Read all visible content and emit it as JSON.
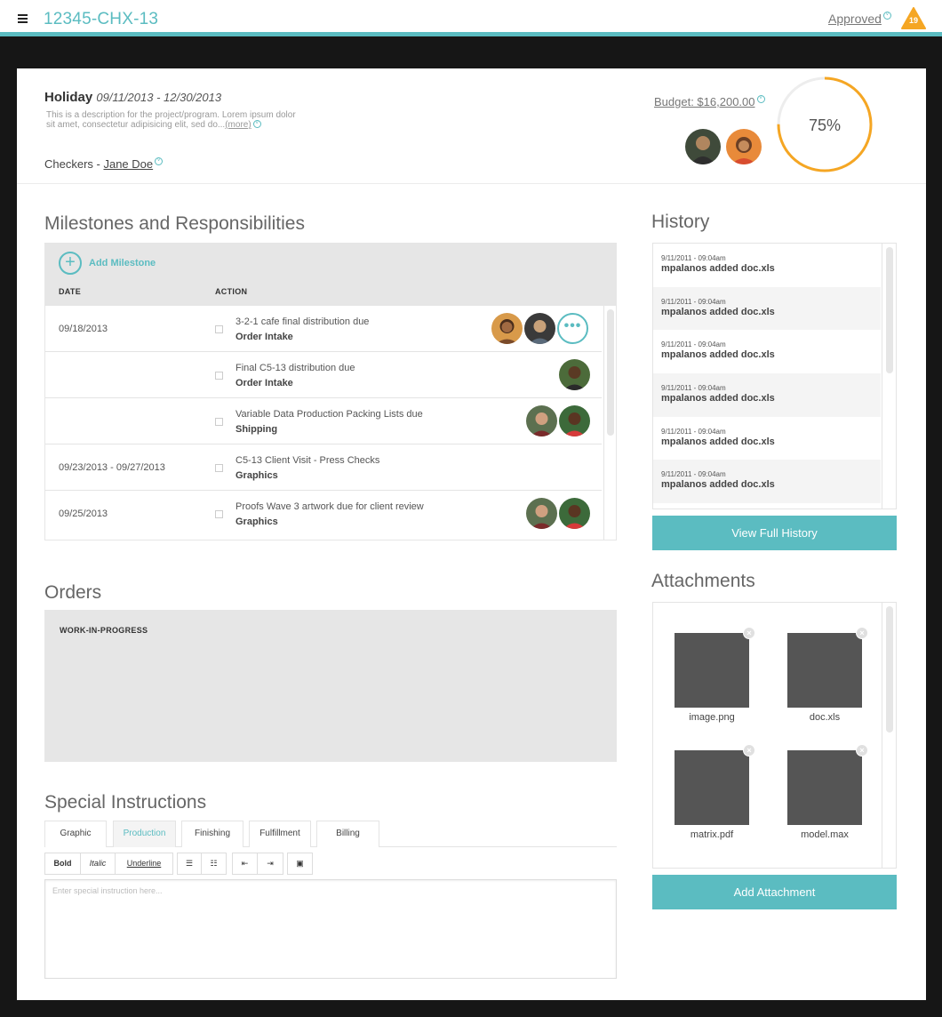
{
  "header": {
    "project_id": "12345-CHX-13",
    "status": "Approved",
    "alert_count": "19"
  },
  "project": {
    "name": "Holiday",
    "dates": "09/11/2013 - 12/30/2013",
    "description": "This is a description for the project/program. Lorem ipsum dolor sit amet, consectetur adipisicing elit, sed do...",
    "more_link": "(more)",
    "checkers_label": "Checkers - ",
    "checker_name": "Jane Doe",
    "budget": "Budget: $16,200.00",
    "progress_text": "75%",
    "progress_value": 0.75
  },
  "milestones": {
    "title": "Milestones and Responsibilities",
    "add_label": "Add Milestone",
    "col_date": "DATE",
    "col_action": "ACTION",
    "rows": [
      {
        "date": "09/18/2013",
        "task": "3-2-1 cafe final distribution due",
        "dept": "Order Intake"
      },
      {
        "date": "",
        "task": "Final C5-13 distribution due",
        "dept": "Order Intake"
      },
      {
        "date": "",
        "task": "Variable Data Production Packing Lists due",
        "dept": "Shipping"
      },
      {
        "date": "09/23/2013 - 09/27/2013",
        "task": "C5-13 Client Visit - Press Checks",
        "dept": "Graphics"
      },
      {
        "date": "09/25/2013",
        "task": "Proofs Wave 3 artwork due for client review",
        "dept": "Graphics"
      }
    ]
  },
  "orders": {
    "title": "Orders",
    "label": "WORK-IN-PROGRESS"
  },
  "special": {
    "title": "Special Instructions",
    "tabs": [
      "Graphic",
      "Production",
      "Finishing",
      "Fulfillment",
      "Billing"
    ],
    "toolbar": {
      "bold": "Bold",
      "italic": "Italic",
      "underline": "Underline"
    },
    "placeholder": "Enter special instruction here..."
  },
  "history": {
    "title": "History",
    "items": [
      {
        "time": "9/11/2011 - 09:04am",
        "msg": "mpalanos added doc.xls"
      },
      {
        "time": "9/11/2011 - 09:04am",
        "msg": "mpalanos added doc.xls"
      },
      {
        "time": "9/11/2011 - 09:04am",
        "msg": "mpalanos added doc.xls"
      },
      {
        "time": "9/11/2011 - 09:04am",
        "msg": "mpalanos added doc.xls"
      },
      {
        "time": "9/11/2011 - 09:04am",
        "msg": "mpalanos added doc.xls"
      },
      {
        "time": "9/11/2011 - 09:04am",
        "msg": "mpalanos added doc.xls"
      }
    ],
    "button": "View Full History"
  },
  "attachments": {
    "title": "Attachments",
    "files": [
      "image.png",
      "doc.xls",
      "matrix.pdf",
      "model.max"
    ],
    "button": "Add Attachment"
  },
  "colors": {
    "accent": "#5bbcc1",
    "ring": "#f5a623",
    "alert": "#f5a623"
  }
}
